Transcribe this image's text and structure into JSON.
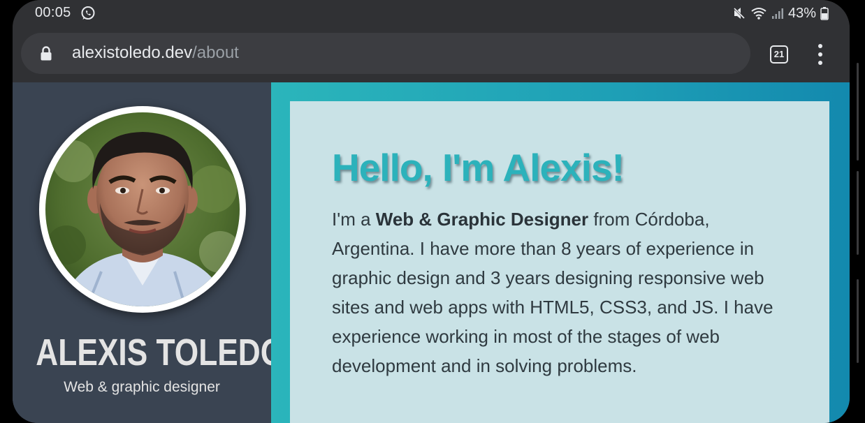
{
  "status_bar": {
    "time": "00:05",
    "battery": "43%",
    "icons": [
      "whatsapp-icon",
      "mute-icon",
      "wifi-icon",
      "signal-icon",
      "battery-icon"
    ]
  },
  "browser": {
    "url_domain": "alexistoledo.dev",
    "url_path": "/about",
    "tab_count": "21",
    "icons": [
      "lock-icon",
      "tabs-icon",
      "more-vert-icon"
    ]
  },
  "profile": {
    "name": "ALEXIS TOLEDO",
    "role": "Web & graphic designer",
    "photo": "profile-photo"
  },
  "about": {
    "heading": "Hello, I'm Alexis!",
    "intro_before": "I'm a ",
    "intro_bold": "Web & Graphic Designer",
    "intro_after": " from Córdoba, Argentina. I have more than 8 years of experience in graphic design and 3 years designing responsive web sites and web apps with HTML5, CSS3, and JS. I have experience working in most of the stages of web development and in solving problems."
  },
  "colors": {
    "browser_chrome": "#303134",
    "url_pill": "#3c3d41",
    "sidebar": "#3a4452",
    "accent_teal": "#2cb2bb",
    "card": "#c9e2e6",
    "body_text": "#2f3a40"
  }
}
